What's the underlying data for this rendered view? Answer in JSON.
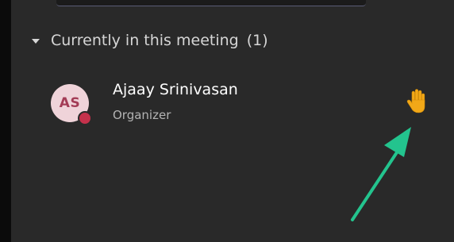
{
  "section": {
    "title": "Currently in this meeting",
    "count": "(1)",
    "icon": "chevron-down-icon"
  },
  "participant": {
    "initials": "AS",
    "name": "Ajaay Srinivasan",
    "role": "Organizer",
    "presence_color": "#c4314b",
    "avatar_bg": "#efd3d9",
    "status_icon": "raised-hand-icon",
    "status_color": "#f2a818"
  },
  "annotation": {
    "arrow_color": "#23c48e"
  }
}
